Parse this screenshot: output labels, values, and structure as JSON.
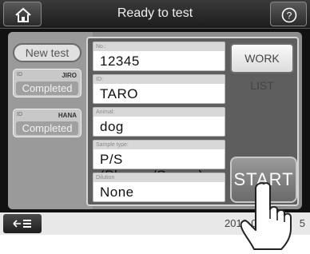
{
  "header": {
    "title": "Ready to test"
  },
  "left": {
    "new_test": "New test",
    "patients": [
      {
        "id_label": "ID",
        "name": "JIRO",
        "status": "Completed"
      },
      {
        "id_label": "ID",
        "name": "HANA",
        "status": "Completed"
      }
    ]
  },
  "form": {
    "fields": [
      {
        "label": "No.:",
        "value": "12345"
      },
      {
        "label": "ID:",
        "value": "TARO"
      },
      {
        "label": "Animal:",
        "value": "dog"
      },
      {
        "label": "Sample type:",
        "value": "P/S (Plasma/Serum)"
      },
      {
        "label": "Dilution",
        "value": "None"
      }
    ],
    "worklist_label": "WORK LIST",
    "start_label": "START"
  },
  "footer": {
    "datetime": "2012-04",
    "datetime_tail": "5"
  },
  "icons": {
    "home": "home-icon",
    "help": "help-icon",
    "back": "back-list-icon",
    "hand": "pointing-hand-icon"
  },
  "colors": {
    "topbar": "#2a2a2a",
    "panel": "#8c8c8c",
    "field_bg": "#ffffff"
  }
}
